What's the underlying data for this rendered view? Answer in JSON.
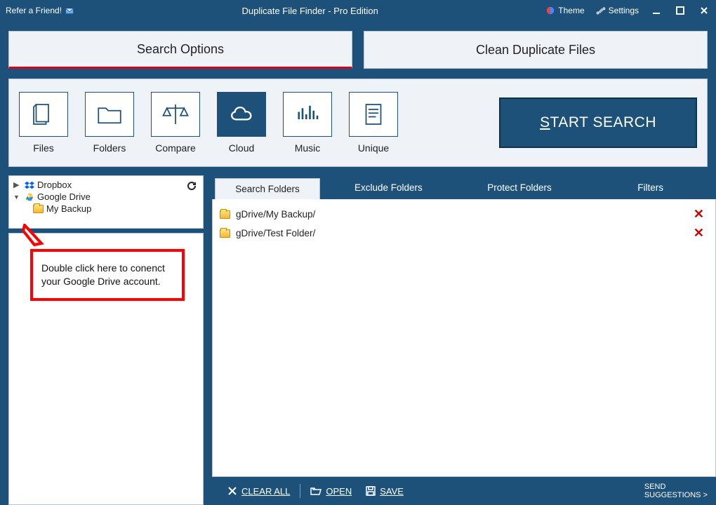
{
  "titlebar": {
    "refer": "Refer a Friend!",
    "title": "Duplicate File Finder - Pro Edition",
    "theme": "Theme",
    "settings": "Settings"
  },
  "tabs": {
    "search_options": "Search Options",
    "clean_duplicates": "Clean Duplicate Files"
  },
  "toolbar": {
    "files": "Files",
    "folders": "Folders",
    "compare": "Compare",
    "cloud": "Cloud",
    "music": "Music",
    "unique": "Unique",
    "start": "TART SEARCH",
    "start_u": "S"
  },
  "tree": {
    "dropbox": "Dropbox",
    "gdrive": "Google Drive",
    "items": [
      {
        "label": "My Backup"
      }
    ]
  },
  "callout": "Double click here to conenct your Google Drive account.",
  "subtabs": {
    "search": "Search Folders",
    "exclude": "Exclude Folders",
    "protect": "Protect Folders",
    "filters": "Filters"
  },
  "list": [
    {
      "path": "gDrive/My Backup/"
    },
    {
      "path": "gDrive/Test Folder/"
    }
  ],
  "footer": {
    "clear": "CLEAR ALL",
    "open": "OPEN",
    "save": "SAVE",
    "send1": "SEND",
    "send2": "SUGGESTIONS >"
  }
}
